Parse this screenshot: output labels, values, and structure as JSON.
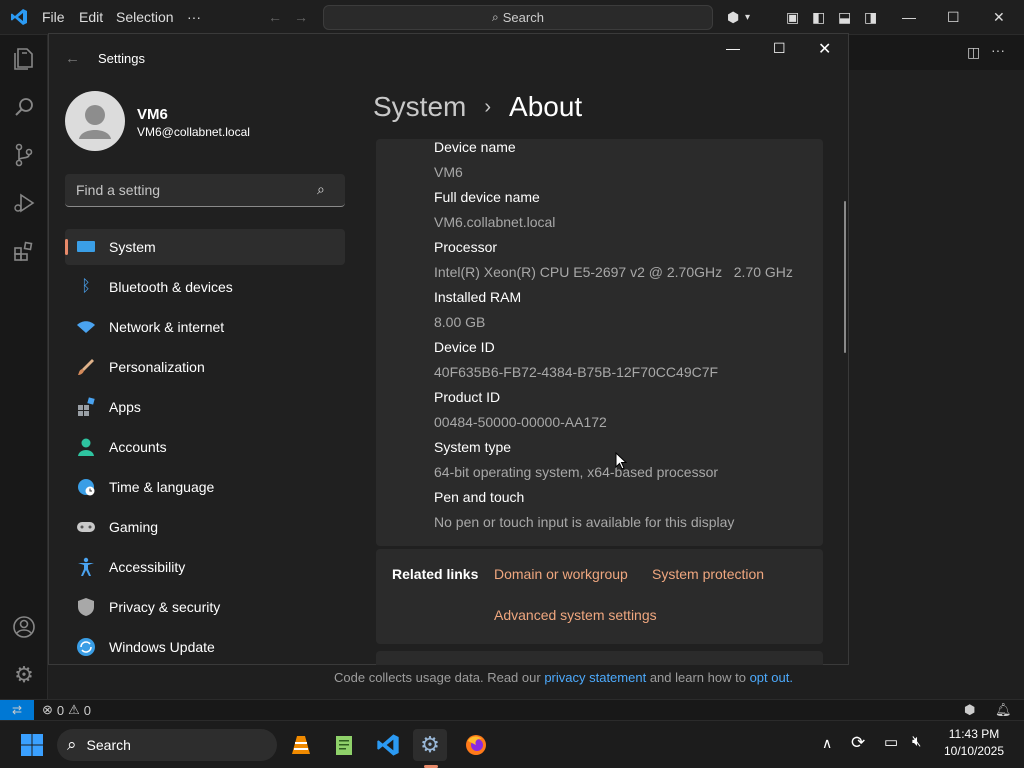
{
  "vscode": {
    "menu": [
      "File",
      "Edit",
      "Selection",
      "···"
    ],
    "search_placeholder": "Search",
    "footer_notice_prefix": "Code collects usage data. Read our",
    "footer_link1": "privacy statement",
    "footer_notice_middle": "and learn how to",
    "footer_link2": "opt out.",
    "status_errors": "0",
    "status_warnings": "0"
  },
  "settings": {
    "window_title": "Settings",
    "user": {
      "name": "VM6",
      "email": "VM6@collabnet.local"
    },
    "search_placeholder": "Find a setting",
    "breadcrumb": {
      "parent": "System",
      "sep": "›",
      "current": "About"
    },
    "nav": [
      {
        "label": "System",
        "icon": "system-icon"
      },
      {
        "label": "Bluetooth & devices",
        "icon": "bluetooth-icon"
      },
      {
        "label": "Network & internet",
        "icon": "wifi-icon"
      },
      {
        "label": "Personalization",
        "icon": "brush-icon"
      },
      {
        "label": "Apps",
        "icon": "apps-icon"
      },
      {
        "label": "Accounts",
        "icon": "accounts-icon"
      },
      {
        "label": "Time & language",
        "icon": "globe-clock-icon"
      },
      {
        "label": "Gaming",
        "icon": "gamepad-icon"
      },
      {
        "label": "Accessibility",
        "icon": "accessibility-icon"
      },
      {
        "label": "Privacy & security",
        "icon": "shield-icon"
      },
      {
        "label": "Windows Update",
        "icon": "update-icon"
      }
    ],
    "specs": [
      {
        "label": "Device name",
        "value": "VM6"
      },
      {
        "label": "Full device name",
        "value": "VM6.collabnet.local"
      },
      {
        "label": "Processor",
        "value": "Intel(R) Xeon(R) CPU E5-2697 v2 @ 2.70GHz   2.70 GHz"
      },
      {
        "label": "Installed RAM",
        "value": "8.00 GB"
      },
      {
        "label": "Device ID",
        "value": "40F635B6-FB72-4384-B75B-12F70CC49C7F"
      },
      {
        "label": "Product ID",
        "value": "00484-50000-00000-AA172"
      },
      {
        "label": "System type",
        "value": "64-bit operating system, x64-based processor"
      },
      {
        "label": "Pen and touch",
        "value": "No pen or touch input is available for this display"
      }
    ],
    "related": {
      "title": "Related links",
      "links": [
        "Domain or workgroup",
        "System protection",
        "Advanced system settings"
      ]
    }
  },
  "taskbar": {
    "search_label": "Search",
    "clock_time": "11:43 PM",
    "clock_date": "10/10/2025"
  },
  "colors": {
    "accent": "#e88a6a",
    "link": "#f0a77f",
    "vscode_blue": "#0078d4"
  }
}
